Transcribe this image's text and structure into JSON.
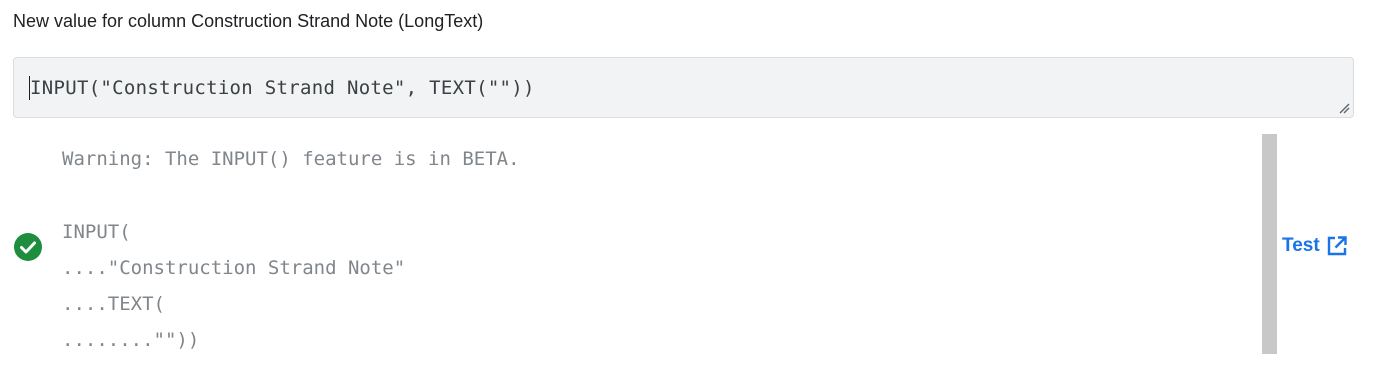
{
  "header": {
    "title": "New value for column Construction Strand Note (LongText)"
  },
  "editor": {
    "value": "INPUT(\"Construction Strand Note\", TEXT(\"\"))"
  },
  "result": {
    "warning": "Warning: The INPUT() feature is in BETA.",
    "status_icon": "check-circle-icon",
    "status_color": "#1e8e3e",
    "lines": [
      "INPUT(",
      "....\"Construction Strand Note\"",
      "....TEXT(",
      "........\"\"))"
    ]
  },
  "actions": {
    "test_label": "Test",
    "test_icon": "open-in-new-icon",
    "link_color": "#1a73e8"
  }
}
